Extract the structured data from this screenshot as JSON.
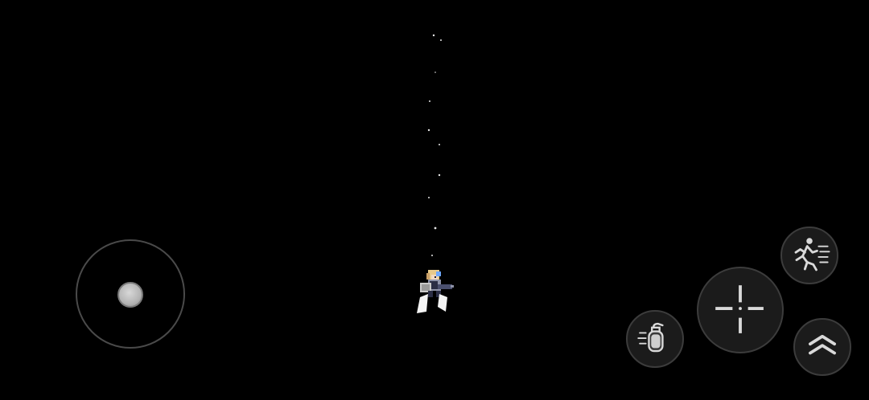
{
  "scene": {
    "background": "#000000",
    "character": "armored-soldier-with-gun",
    "projectile_trail": "particle-sparks"
  },
  "controls": {
    "movement": {
      "name": "virtual-joystick"
    },
    "dash": {
      "name": "dash-button",
      "icon": "running-figure-icon"
    },
    "fire": {
      "name": "fire-button",
      "icon": "crosshair-icon"
    },
    "grenade": {
      "name": "grenade-button",
      "icon": "grenade-icon"
    },
    "jump": {
      "name": "jump-button",
      "icon": "double-chevron-up-icon"
    }
  },
  "colors": {
    "button_fill": "#1b1b1b",
    "button_border": "#3c3c3c",
    "icon": "#d9d9d9",
    "joystick_knob": "#b4b4b4"
  }
}
